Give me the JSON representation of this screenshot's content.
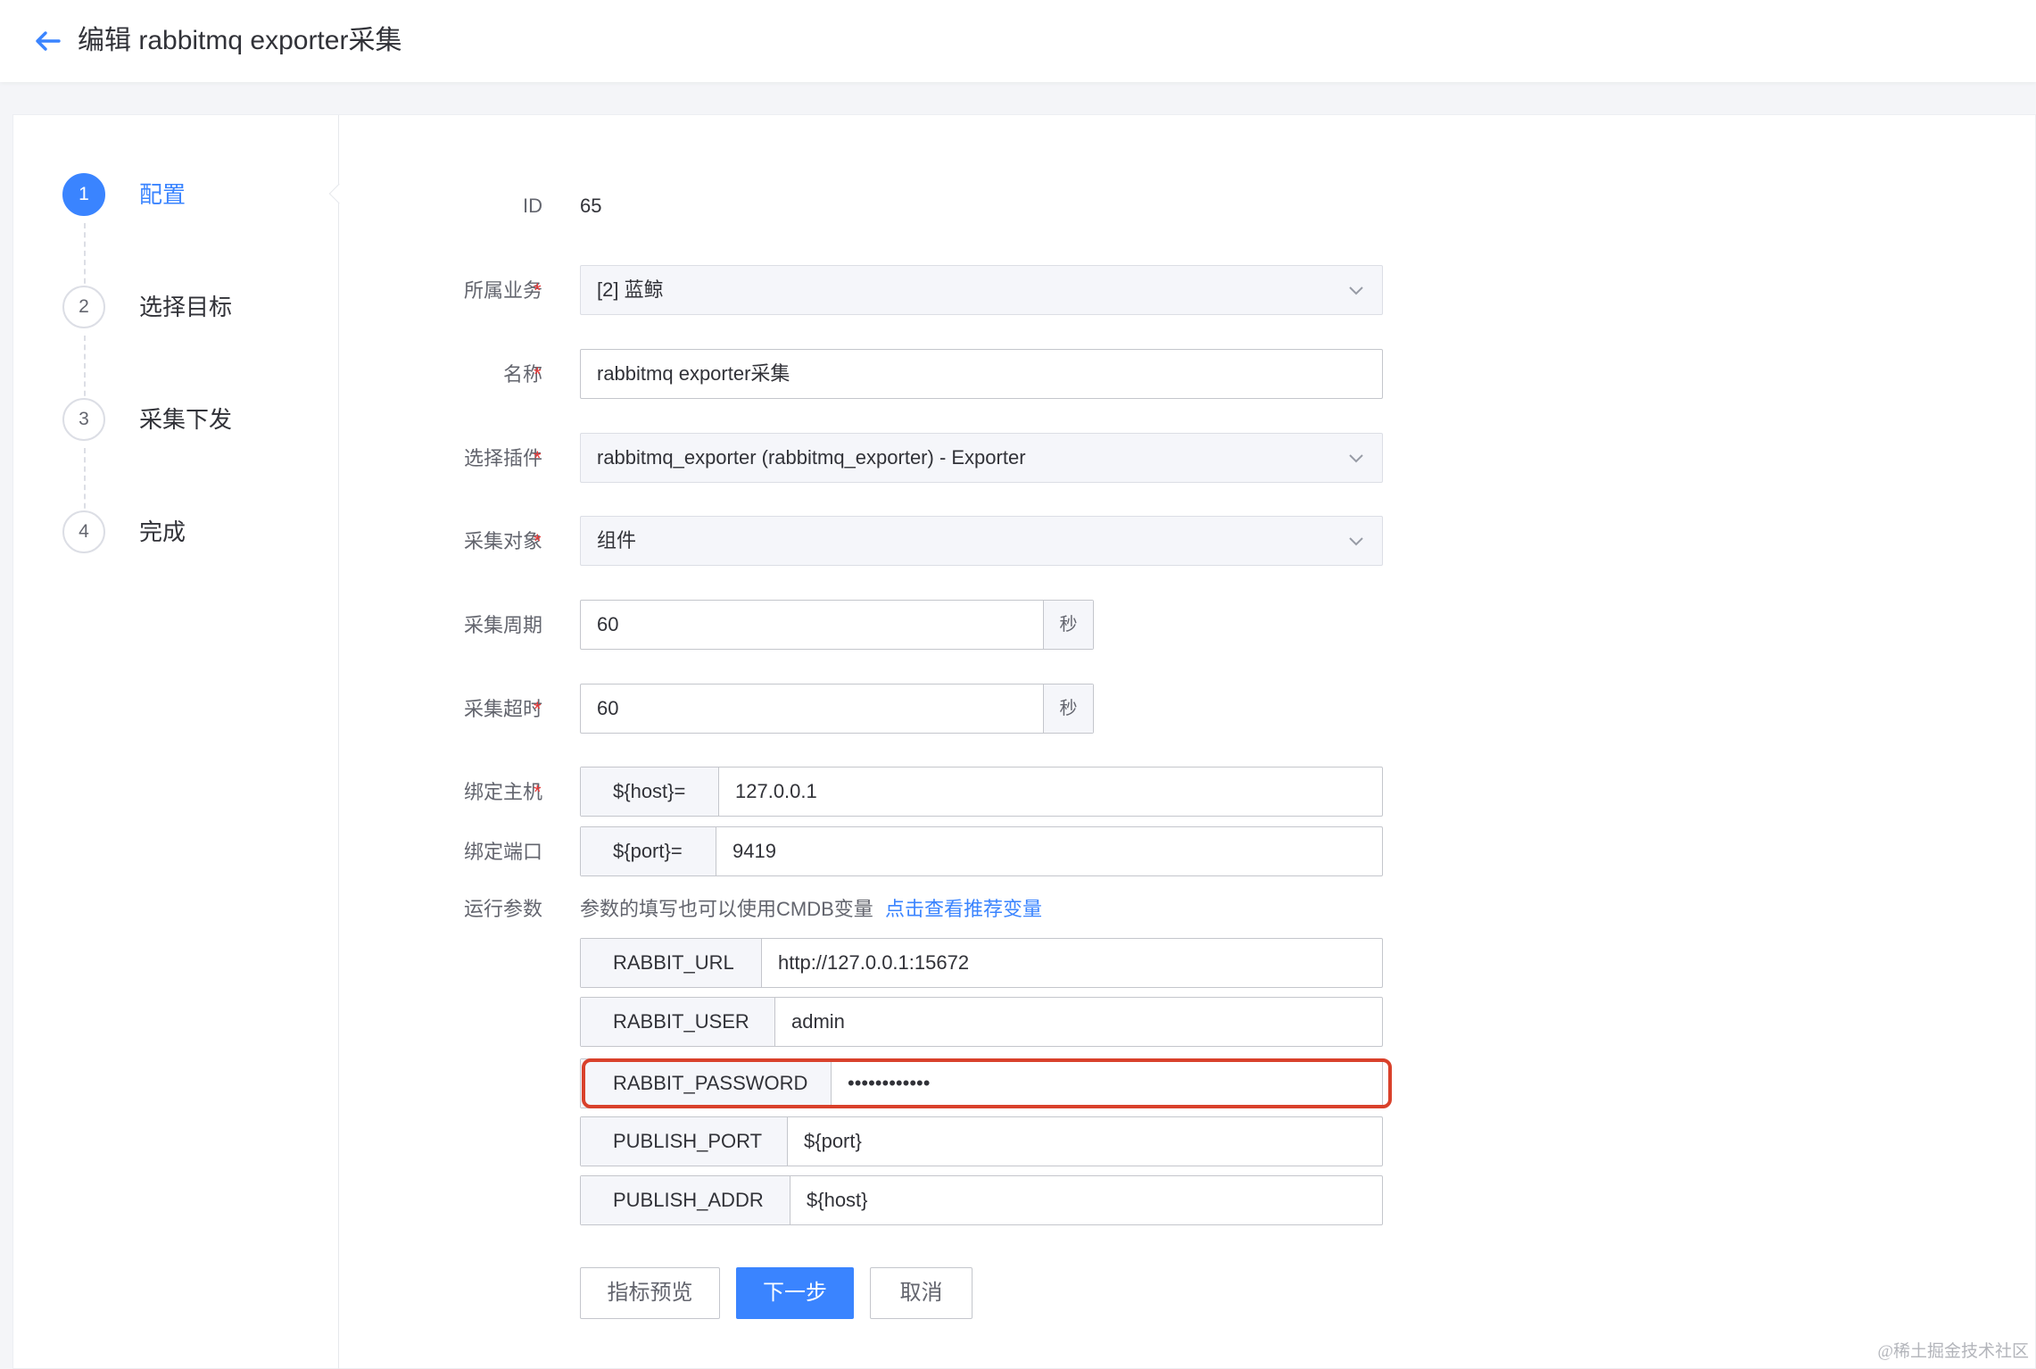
{
  "header": {
    "title": "编辑 rabbitmq exporter采集"
  },
  "steps": [
    {
      "num": "1",
      "label": "配置"
    },
    {
      "num": "2",
      "label": "选择目标"
    },
    {
      "num": "3",
      "label": "采集下发"
    },
    {
      "num": "4",
      "label": "完成"
    }
  ],
  "form": {
    "id": {
      "label": "ID",
      "value": "65"
    },
    "business": {
      "label": "所属业务",
      "value": "[2] 蓝鲸"
    },
    "name": {
      "label": "名称",
      "value": "rabbitmq exporter采集"
    },
    "plugin": {
      "label": "选择插件",
      "value": "rabbitmq_exporter (rabbitmq_exporter) - Exporter"
    },
    "target": {
      "label": "采集对象",
      "value": "组件"
    },
    "period": {
      "label": "采集周期",
      "value": "60",
      "unit": "秒"
    },
    "timeout": {
      "label": "采集超时",
      "value": "60",
      "unit": "秒"
    },
    "host": {
      "label": "绑定主机",
      "key": "${host}=",
      "value": "127.0.0.1"
    },
    "port": {
      "label": "绑定端口",
      "key": "${port}=",
      "value": "9419"
    },
    "params": {
      "label": "运行参数",
      "tip": "参数的填写也可以使用CMDB变量",
      "link": "点击查看推荐变量",
      "items": [
        {
          "key": "RABBIT_URL",
          "value": "http://127.0.0.1:15672"
        },
        {
          "key": "RABBIT_USER",
          "value": "admin"
        },
        {
          "key": "RABBIT_PASSWORD",
          "value": "••••••••••••"
        },
        {
          "key": "PUBLISH_PORT",
          "value": "${port}"
        },
        {
          "key": "PUBLISH_ADDR",
          "value": "${host}"
        }
      ]
    },
    "required_mark": "*"
  },
  "buttons": {
    "preview": "指标预览",
    "next": "下一步",
    "cancel": "取消"
  },
  "colors": {
    "primary": "#3a84ff",
    "required": "#ea3636",
    "highlight": "#d9412b"
  },
  "watermark": "@稀土掘金技术社区"
}
